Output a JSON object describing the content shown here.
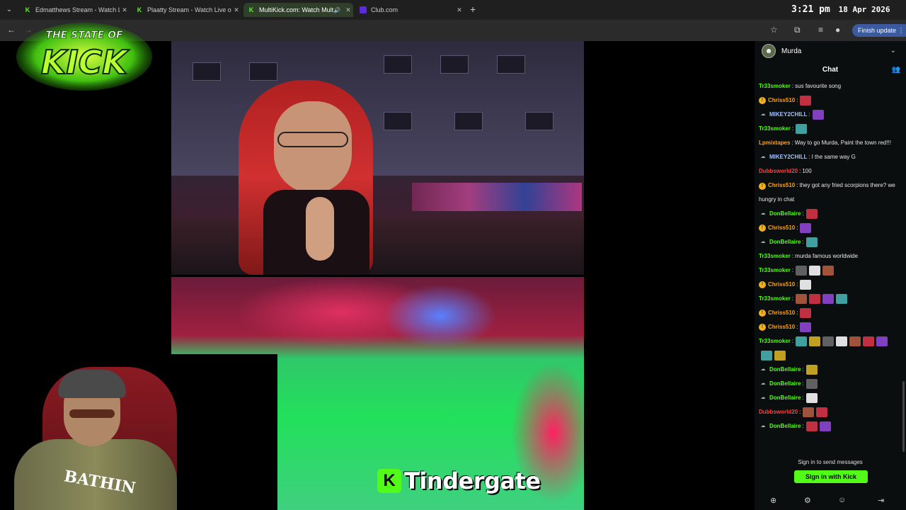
{
  "browser": {
    "tabs": [
      {
        "title": "Edmatthews Stream - Watch Live",
        "favicon": "kick-icon"
      },
      {
        "title": "Plaatty Stream - Watch Live on",
        "favicon": "kick-icon"
      },
      {
        "title": "MultiKick.com: Watch Multi",
        "favicon": "multikick-icon",
        "active": true
      },
      {
        "title": "Club.com",
        "favicon": "club-icon"
      }
    ],
    "finish_update_label": "Finish update"
  },
  "clock": {
    "time": "3:21 pm",
    "date": "18 Apr 2026"
  },
  "overlay": {
    "logo_text_top": "THE STATE OF",
    "logo_text_main": "KICK"
  },
  "webcam": {
    "shirt_text": "BATHIN"
  },
  "caption": {
    "k_letter": "K",
    "text": "Tindergate"
  },
  "chat": {
    "streamer": "Murda",
    "title": "Chat",
    "messages": [
      {
        "user": "Tr33smoker",
        "color": "green",
        "badge": "",
        "text": "sus favourite song",
        "emotes": 0
      },
      {
        "user": "Chriss510",
        "color": "orange",
        "badge": "coin",
        "text": "",
        "emotes": 1
      },
      {
        "user": "MIKEY2CHILL",
        "color": "blue",
        "badge": "ghost",
        "text": "",
        "emotes": 1
      },
      {
        "user": "Tr33smoker",
        "color": "green",
        "badge": "",
        "text": "",
        "emotes": 1
      },
      {
        "user": "Lpmixtapes",
        "color": "orange",
        "badge": "",
        "text": "Way to go Murda, Paint the town red!!!",
        "emotes": 0,
        "wrap": true
      },
      {
        "user": "MIKEY2CHILL",
        "color": "blue",
        "badge": "ghost",
        "text": "I the same way G",
        "emotes": 0
      },
      {
        "user": "Dubbsworld20",
        "color": "red",
        "badge": "",
        "text": "100",
        "emotes": 0
      },
      {
        "user": "Chriss510",
        "color": "orange",
        "badge": "coin",
        "text": "they got any fried scorpions there? we hungry in chat",
        "emotes": 0,
        "wrap": true
      },
      {
        "user": "DonBellaire",
        "color": "green",
        "badge": "ghost",
        "text": "",
        "emotes": 1
      },
      {
        "user": "Chriss510",
        "color": "orange",
        "badge": "coin",
        "text": "",
        "emotes": 1
      },
      {
        "user": "DonBellaire",
        "color": "green",
        "badge": "ghost",
        "text": "",
        "emotes": 1
      },
      {
        "user": "Tr33smoker",
        "color": "green",
        "badge": "",
        "text": "murda famous worldwide",
        "emotes": 0
      },
      {
        "user": "Tr33smoker",
        "color": "green",
        "badge": "",
        "text": "",
        "emotes": 3
      },
      {
        "user": "Chriss510",
        "color": "orange",
        "badge": "coin",
        "text": "",
        "emotes": 1
      },
      {
        "user": "Tr33smoker",
        "color": "green",
        "badge": "",
        "text": "",
        "emotes": 4
      },
      {
        "user": "Chriss510",
        "color": "orange",
        "badge": "coin",
        "text": "",
        "emotes": 1
      },
      {
        "user": "Chriss510",
        "color": "orange",
        "badge": "coin",
        "text": "",
        "emotes": 1
      },
      {
        "user": "Tr33smoker",
        "color": "green",
        "badge": "",
        "text": "",
        "emotes": 9,
        "wrap": true
      },
      {
        "user": "DonBellaire",
        "color": "green",
        "badge": "ghost",
        "text": "",
        "emotes": 1
      },
      {
        "user": "DonBellaire",
        "color": "green",
        "badge": "ghost",
        "text": "",
        "emotes": 1
      },
      {
        "user": "DonBellaire",
        "color": "green",
        "badge": "ghost",
        "text": "",
        "emotes": 1
      },
      {
        "user": "Dubbsworld20",
        "color": "red",
        "badge": "",
        "text": "",
        "emotes": 2
      },
      {
        "user": "DonBellaire",
        "color": "green",
        "badge": "ghost",
        "text": "",
        "emotes": 2
      }
    ],
    "signin_note": "Sign in to send messages",
    "signin_button": "Sign in with Kick"
  }
}
